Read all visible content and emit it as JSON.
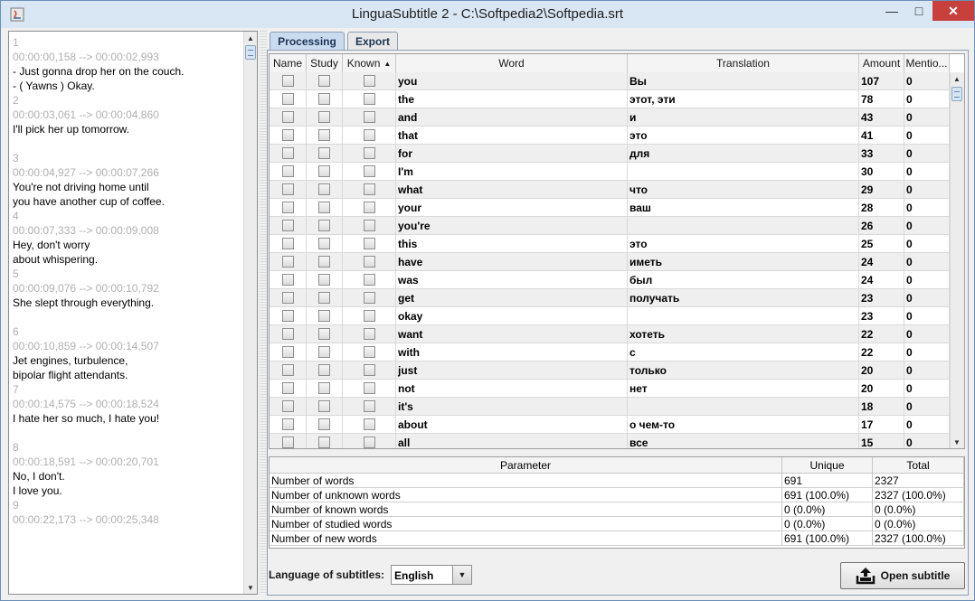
{
  "window": {
    "title": "LinguaSubtitle 2 - C:\\Softpedia2\\Softpedia.srt",
    "minimize_glyph": "—",
    "maximize_glyph": "□",
    "close_glyph": "✕"
  },
  "subtitles": [
    {
      "num": "1",
      "time": "00:00:00,158 --> 00:00:02,993",
      "lines": [
        "- Just gonna drop her on the couch.",
        "- ( Yawns ) Okay."
      ]
    },
    {
      "num": "2",
      "time": "00:00:03,061 --> 00:00:04,860",
      "lines": [
        "I'll pick her up tomorrow.",
        ""
      ]
    },
    {
      "num": "3",
      "time": "00:00:04,927 --> 00:00:07,266",
      "lines": [
        "You're not driving home until",
        "you have another cup of coffee."
      ]
    },
    {
      "num": "4",
      "time": "00:00:07,333 --> 00:00:09,008",
      "lines": [
        "Hey, don't worry",
        "about whispering."
      ]
    },
    {
      "num": "5",
      "time": "00:00:09,076 --> 00:00:10,792",
      "lines": [
        "She slept through everything.",
        ""
      ]
    },
    {
      "num": "6",
      "time": "00:00:10,859 --> 00:00:14,507",
      "lines": [
        "Jet engines, turbulence,",
        "bipolar flight attendants."
      ]
    },
    {
      "num": "7",
      "time": "00:00:14,575 --> 00:00:18,524",
      "lines": [
        "I hate her so much, I hate you!",
        ""
      ]
    },
    {
      "num": "8",
      "time": "00:00:18,591 --> 00:00:20,701",
      "lines": [
        "No, I don't.",
        "I love you."
      ]
    },
    {
      "num": "9",
      "time": "00:00:22,173 --> 00:00:25,348",
      "lines": [
        "",
        ""
      ]
    }
  ],
  "tabs": [
    {
      "label": "Processing",
      "active": true
    },
    {
      "label": "Export",
      "active": false
    }
  ],
  "words_table": {
    "columns": [
      "Name",
      "Study",
      "Known",
      "Word",
      "Translation",
      "Amount",
      "Mentio..."
    ],
    "sort_indicator": "▲",
    "rows": [
      {
        "word": "you",
        "translation": "Вы",
        "amount": "107",
        "mentions": "0"
      },
      {
        "word": "the",
        "translation": "этот, эти",
        "amount": "78",
        "mentions": "0"
      },
      {
        "word": "and",
        "translation": "и",
        "amount": "43",
        "mentions": "0"
      },
      {
        "word": "that",
        "translation": "это",
        "amount": "41",
        "mentions": "0"
      },
      {
        "word": "for",
        "translation": "для",
        "amount": "33",
        "mentions": "0"
      },
      {
        "word": "I'm",
        "translation": "",
        "amount": "30",
        "mentions": "0"
      },
      {
        "word": "what",
        "translation": "что",
        "amount": "29",
        "mentions": "0"
      },
      {
        "word": "your",
        "translation": "ваш",
        "amount": "28",
        "mentions": "0"
      },
      {
        "word": "you're",
        "translation": "",
        "amount": "26",
        "mentions": "0"
      },
      {
        "word": "this",
        "translation": "это",
        "amount": "25",
        "mentions": "0"
      },
      {
        "word": "have",
        "translation": "иметь",
        "amount": "24",
        "mentions": "0"
      },
      {
        "word": "was",
        "translation": "был",
        "amount": "24",
        "mentions": "0"
      },
      {
        "word": "get",
        "translation": "получать",
        "amount": "23",
        "mentions": "0"
      },
      {
        "word": "okay",
        "translation": "",
        "amount": "23",
        "mentions": "0"
      },
      {
        "word": "want",
        "translation": "хотеть",
        "amount": "22",
        "mentions": "0"
      },
      {
        "word": "with",
        "translation": "с",
        "amount": "22",
        "mentions": "0"
      },
      {
        "word": "just",
        "translation": "только",
        "amount": "20",
        "mentions": "0"
      },
      {
        "word": "not",
        "translation": "нет",
        "amount": "20",
        "mentions": "0"
      },
      {
        "word": "it's",
        "translation": "",
        "amount": "18",
        "mentions": "0"
      },
      {
        "word": "about",
        "translation": "о чем-то",
        "amount": "17",
        "mentions": "0"
      },
      {
        "word": "all",
        "translation": "все",
        "amount": "15",
        "mentions": "0"
      }
    ]
  },
  "stats_table": {
    "columns": [
      "Parameter",
      "Unique",
      "Total"
    ],
    "rows": [
      {
        "parameter": "Number of words",
        "unique": "691",
        "total": "2327"
      },
      {
        "parameter": "Number of unknown words",
        "unique": "691 (100.0%)",
        "total": "2327 (100.0%)"
      },
      {
        "parameter": "Number of known words",
        "unique": "0 (0.0%)",
        "total": "0 (0.0%)"
      },
      {
        "parameter": "Number of studied words",
        "unique": "0 (0.0%)",
        "total": "0 (0.0%)"
      },
      {
        "parameter": "Number of new words",
        "unique": "691 (100.0%)",
        "total": "2327 (100.0%)"
      }
    ]
  },
  "language": {
    "label": "Language of subtitles:",
    "selected": "English"
  },
  "open_button": {
    "label": "Open subtitle"
  },
  "colors": {
    "titlebar": "#d9e6f4",
    "close_button": "#c8403c",
    "active_tab": "#c9dbef"
  }
}
